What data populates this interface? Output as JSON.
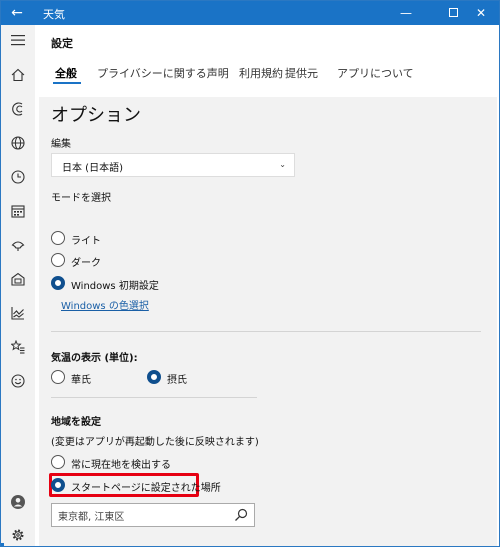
{
  "window": {
    "app_title": "天気",
    "back_glyph": "←",
    "minimize_glyph": "—",
    "close_glyph": "✕"
  },
  "sidebar": {
    "items": [
      {
        "icon": "hamburger-menu-icon"
      },
      {
        "icon": "home-icon"
      },
      {
        "icon": "forecast-icon"
      },
      {
        "icon": "globe-icon"
      },
      {
        "icon": "history-clock-icon"
      },
      {
        "icon": "calendar-icon"
      },
      {
        "icon": "cloud-icon"
      },
      {
        "icon": "news-icon"
      },
      {
        "icon": "chart-icon"
      },
      {
        "icon": "favorites-icon"
      },
      {
        "icon": "smiley-icon"
      },
      {
        "icon": "account-icon"
      },
      {
        "icon": "settings-gear-icon"
      }
    ],
    "active": "settings-gear-icon"
  },
  "header": {
    "title": "設定"
  },
  "tabs": [
    {
      "label": "全般",
      "active": true
    },
    {
      "label": "プライバシーに関する声明",
      "active": false
    },
    {
      "label": "利用規約",
      "active": false
    },
    {
      "label": "提供元",
      "active": false
    },
    {
      "label": "アプリについて",
      "active": false
    }
  ],
  "options": {
    "section_title": "オプション",
    "language": {
      "label": "編集",
      "selected": "日本 (日本語)"
    },
    "mode": {
      "label": "モードを選択",
      "choices": [
        {
          "label": "ライト",
          "checked": false
        },
        {
          "label": "ダーク",
          "checked": false
        },
        {
          "label": "Windows 初期設定",
          "checked": true
        }
      ],
      "color_link": "Windows の色選択"
    },
    "temperature": {
      "label": "気温の表示 (単位):",
      "choices": [
        {
          "label": "華氏",
          "checked": false
        },
        {
          "label": "摂氏",
          "checked": true
        }
      ]
    },
    "location": {
      "label": "地域を設定",
      "note": "(変更はアプリが再起動した後に反映されます)",
      "choices": [
        {
          "label": "常に現在地を検出する",
          "checked": false
        },
        {
          "label": "スタートページに設定された場所",
          "checked": true
        }
      ],
      "search_value": "東京都, 江東区"
    }
  },
  "colors": {
    "accent": "#1a73c6",
    "highlight_border": "#e60012",
    "panel_background": "#f2f2f2"
  }
}
